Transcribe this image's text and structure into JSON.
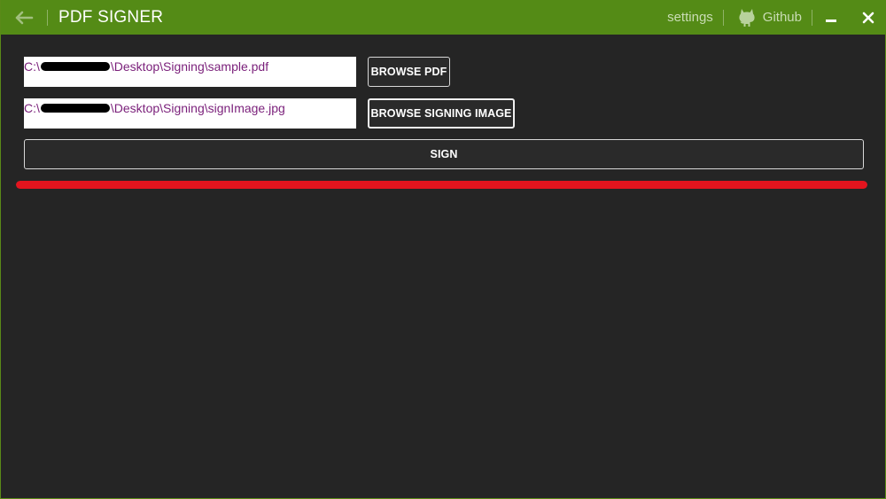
{
  "window": {
    "title": "PDF SIGNER",
    "accent_color": "#548b16",
    "background_color": "#252525"
  },
  "titlebar": {
    "back_icon": "arrow-left-icon",
    "settings_label": "settings",
    "github_label": "Github",
    "github_icon": "github-octocat-icon",
    "minimize_icon": "minimize-icon",
    "close_icon": "close-icon"
  },
  "form": {
    "pdf_path": {
      "prefix": "C:\\",
      "suffix": "\\Desktop\\Signing\\sample.pdf"
    },
    "image_path": {
      "prefix": "C:\\",
      "suffix": "\\Desktop\\Signing\\signImage.jpg"
    },
    "path_text_color": "#7a1f7a",
    "browse_pdf_label": "BROWSE PDF",
    "browse_image_label": "BROWSE SIGNING IMAGE",
    "sign_label": "SIGN"
  },
  "progress": {
    "percent": 100,
    "color": "#e3141e"
  }
}
